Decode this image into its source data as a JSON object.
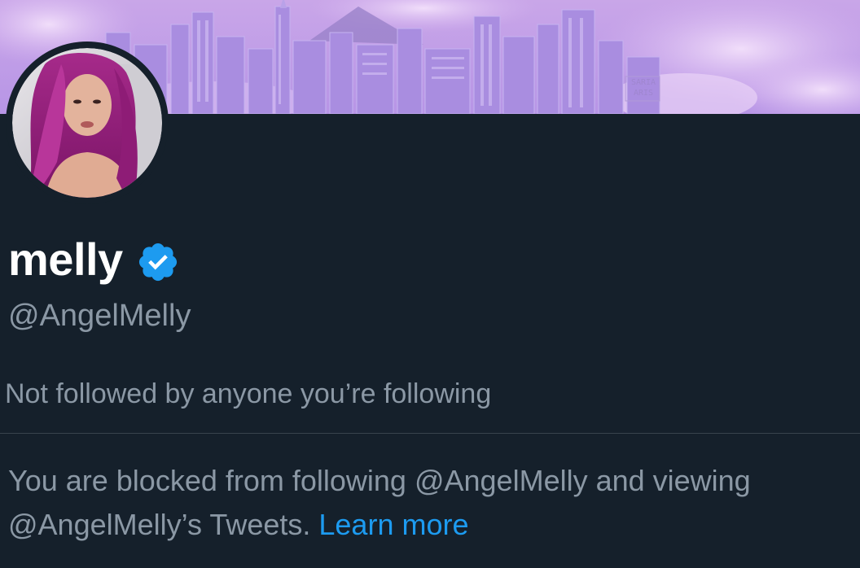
{
  "banner": {
    "watermark_line1": "SARIA",
    "watermark_line2": "ARIS"
  },
  "profile": {
    "display_name": "melly",
    "handle": "@AngelMelly",
    "followers_note": "Not followed by anyone you’re following",
    "verified": true
  },
  "blocked": {
    "message_line1": "You are blocked from following @AngelMelly and viewing",
    "message_line2": "@AngelMelly’s Tweets.",
    "learn_more_label": "Learn more"
  },
  "colors": {
    "background": "#15202b",
    "primary_text": "#ffffff",
    "secondary_text": "#8b98a5",
    "accent": "#1d9bf0",
    "divider": "#38444d"
  }
}
